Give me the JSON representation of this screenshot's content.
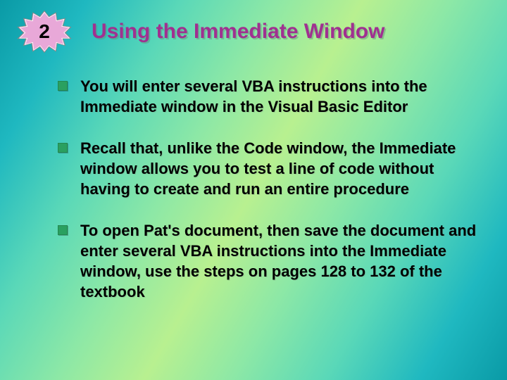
{
  "badge": {
    "number": "2"
  },
  "title": "Using the Immediate Window",
  "bullets": [
    "You will enter several VBA instructions into the Immediate window in the Visual Basic Editor",
    "Recall that, unlike the Code window, the Immediate window allows you to test a line of code without having to create and run an entire procedure",
    "To open Pat's document, then save the document and enter several VBA instructions into the Immediate window, use the steps on pages 128 to 132 of the textbook"
  ]
}
